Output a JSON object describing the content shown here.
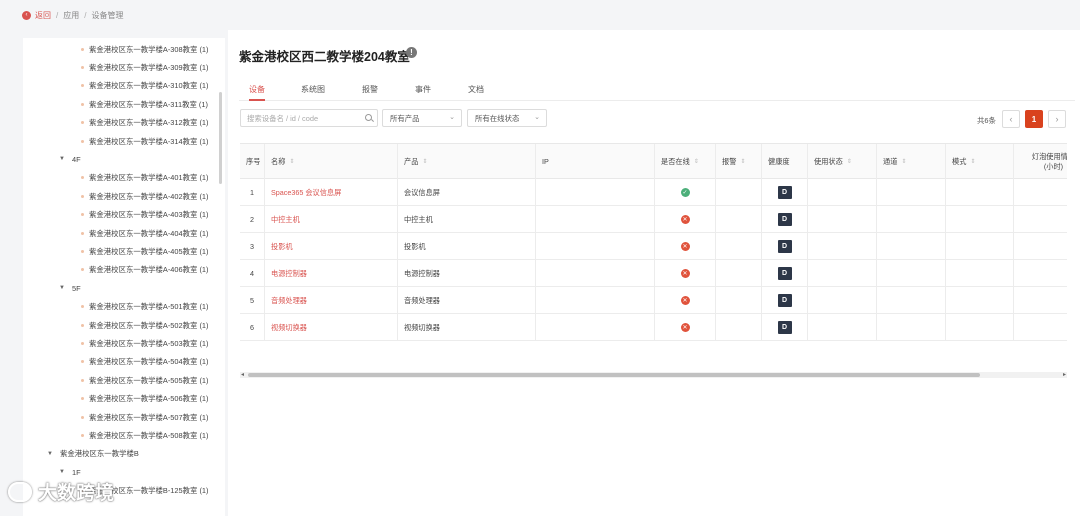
{
  "breadcrumb": {
    "back": "返回",
    "sep": "/",
    "app": "应用",
    "current": "设备管理"
  },
  "tree": [
    {
      "type": "leaf",
      "label": "紫金港校区东一教学楼A-308教室 (1)"
    },
    {
      "type": "leaf",
      "label": "紫金港校区东一教学楼A-309教室 (1)"
    },
    {
      "type": "leaf",
      "label": "紫金港校区东一教学楼A-310教室 (1)"
    },
    {
      "type": "leaf",
      "label": "紫金港校区东一教学楼A-311教室 (1)"
    },
    {
      "type": "leaf",
      "label": "紫金港校区东一教学楼A-312教室 (1)"
    },
    {
      "type": "leaf",
      "label": "紫金港校区东一教学楼A-314教室 (1)"
    },
    {
      "type": "floor",
      "label": "4F"
    },
    {
      "type": "leaf",
      "label": "紫金港校区东一教学楼A-401教室 (1)"
    },
    {
      "type": "leaf",
      "label": "紫金港校区东一教学楼A-402教室 (1)"
    },
    {
      "type": "leaf",
      "label": "紫金港校区东一教学楼A-403教室 (1)"
    },
    {
      "type": "leaf",
      "label": "紫金港校区东一教学楼A-404教室 (1)"
    },
    {
      "type": "leaf",
      "label": "紫金港校区东一教学楼A-405教室 (1)"
    },
    {
      "type": "leaf",
      "label": "紫金港校区东一教学楼A-406教室 (1)"
    },
    {
      "type": "floor",
      "label": "5F"
    },
    {
      "type": "leaf",
      "label": "紫金港校区东一教学楼A-501教室 (1)"
    },
    {
      "type": "leaf",
      "label": "紫金港校区东一教学楼A-502教室 (1)"
    },
    {
      "type": "leaf",
      "label": "紫金港校区东一教学楼A-503教室 (1)"
    },
    {
      "type": "leaf",
      "label": "紫金港校区东一教学楼A-504教室 (1)"
    },
    {
      "type": "leaf",
      "label": "紫金港校区东一教学楼A-505教室 (1)"
    },
    {
      "type": "leaf",
      "label": "紫金港校区东一教学楼A-506教室 (1)"
    },
    {
      "type": "leaf",
      "label": "紫金港校区东一教学楼A-507教室 (1)"
    },
    {
      "type": "leaf",
      "label": "紫金港校区东一教学楼A-508教室 (1)"
    },
    {
      "type": "building",
      "label": "紫金港校区东一教学楼B"
    },
    {
      "type": "floor",
      "label": "1F"
    },
    {
      "type": "leaf",
      "label": "紫金港校区东一教学楼B-125教室 (1)"
    }
  ],
  "watermark": "大数跨境",
  "page_title": "紫金港校区西二教学楼204教室",
  "info_icon": "!",
  "tabs": [
    "设备",
    "系统图",
    "报警",
    "事件",
    "文档"
  ],
  "filters": {
    "search_placeholder": "搜索设备名 / id / code",
    "product": "所有产品",
    "online_status": "所有在线状态"
  },
  "pagination": {
    "total": "共6条",
    "prev": "‹",
    "current": "1",
    "next": "›"
  },
  "table": {
    "columns": [
      "序号",
      "名称",
      "产品",
      "IP",
      "是否在线",
      "报警",
      "健康度",
      "使用状态",
      "通道",
      "模式",
      "灯泡使用情况",
      "(小时)"
    ],
    "rows": [
      {
        "index": "1",
        "name": "Space365 会议信息屏",
        "product": "会议信息屏",
        "online": true,
        "health": "D"
      },
      {
        "index": "2",
        "name": "中控主机",
        "product": "中控主机",
        "online": false,
        "health": "D"
      },
      {
        "index": "3",
        "name": "投影机",
        "product": "投影机",
        "online": false,
        "health": "D"
      },
      {
        "index": "4",
        "name": "电源控制器",
        "product": "电源控制器",
        "online": false,
        "health": "D"
      },
      {
        "index": "5",
        "name": "音频处理器",
        "product": "音频处理器",
        "online": false,
        "health": "D"
      },
      {
        "index": "6",
        "name": "视频切换器",
        "product": "视频切换器",
        "online": false,
        "health": "D"
      }
    ]
  },
  "colors": {
    "accent": "#d9534f",
    "online": "#4caf7a",
    "offline": "#e0533c",
    "badge": "#2d3748"
  },
  "icons": {
    "online": "check-icon",
    "offline": "cross-icon",
    "sort": "sort-icon"
  }
}
